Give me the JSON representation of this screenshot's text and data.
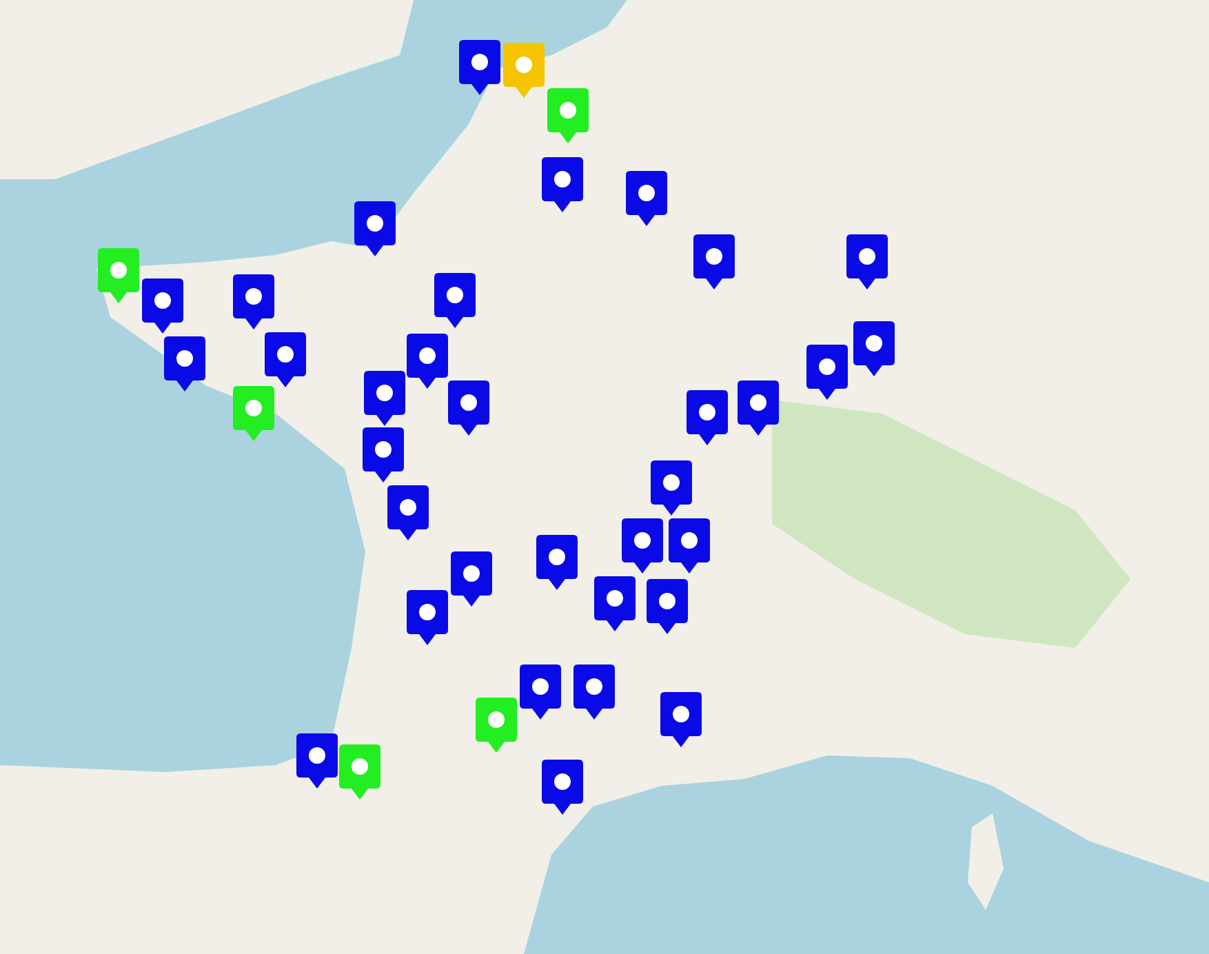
{
  "markers": [
    {
      "color": "#0a0ae6"
    },
    {
      "color": "#f5c400"
    },
    {
      "color": "#22ee22"
    },
    {
      "color": "#0a0ae6"
    },
    {
      "color": "#0a0ae6"
    },
    {
      "color": "#0a0ae6"
    },
    {
      "color": "#0a0ae6"
    },
    {
      "color": "#0a0ae6"
    },
    {
      "color": "#22ee22"
    },
    {
      "color": "#0a0ae6"
    },
    {
      "color": "#0a0ae6"
    },
    {
      "color": "#0a0ae6"
    },
    {
      "color": "#0a0ae6"
    },
    {
      "color": "#0a0ae6"
    },
    {
      "color": "#0a0ae6"
    },
    {
      "color": "#0a0ae6"
    },
    {
      "color": "#0a0ae6"
    },
    {
      "color": "#22ee22"
    },
    {
      "color": "#0a0ae6"
    },
    {
      "color": "#0a0ae6"
    },
    {
      "color": "#0a0ae6"
    },
    {
      "color": "#0a0ae6"
    },
    {
      "color": "#0a0ae6"
    },
    {
      "color": "#0a0ae6"
    },
    {
      "color": "#0a0ae6"
    },
    {
      "color": "#0a0ae6"
    },
    {
      "color": "#0a0ae6"
    },
    {
      "color": "#0a0ae6"
    },
    {
      "color": "#0a0ae6"
    },
    {
      "color": "#0a0ae6"
    },
    {
      "color": "#0a0ae6"
    },
    {
      "color": "#0a0ae6"
    },
    {
      "color": "#0a0ae6"
    },
    {
      "color": "#0a0ae6"
    },
    {
      "color": "#0a0ae6"
    },
    {
      "color": "#22ee22"
    },
    {
      "color": "#0a0ae6"
    },
    {
      "color": "#22ee22"
    },
    {
      "color": "#0a0ae6"
    }
  ]
}
